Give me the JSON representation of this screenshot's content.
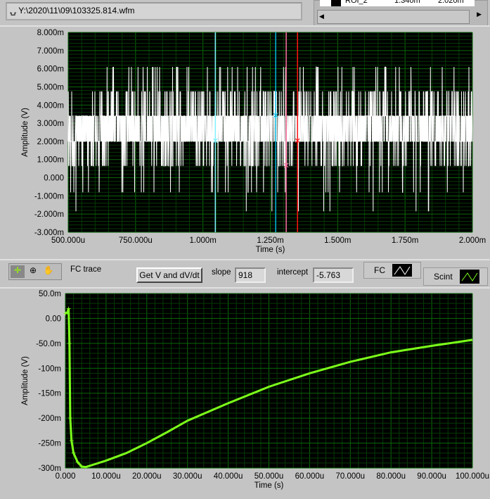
{
  "file_path": "Y:\\2020\\11\\09\\103325.814.wfm",
  "roi_table": {
    "row": [
      "ROI_2",
      "1.340m",
      "2.020m"
    ]
  },
  "toolbar": {
    "graph_name": "FC trace",
    "get_button": "Get V and dV/dt",
    "slope_label": "slope",
    "slope_value": "918",
    "intercept_label": "intercept",
    "intercept_value": "-5.763",
    "fc_label": "FC",
    "scint_label": "Scint",
    "tools": [
      "cursor-tool-icon",
      "zoom-tool-icon",
      "pan-hand-icon"
    ]
  },
  "colors": {
    "plot_bg": "#000000",
    "grid": "#0a6a0a",
    "trace_top": "#ffffff",
    "trace_bottom": "#7cff1a",
    "cursor_1": "#7ff0ff",
    "cursor_2": "#00b8e0",
    "cursor_3": "#ff6f9f",
    "cursor_4": "#ff1010"
  },
  "chart_data": [
    {
      "type": "line",
      "xlabel": "Time (s)",
      "ylabel": "Amplitude (V)",
      "xlim": [
        0.0005,
        0.002
      ],
      "ylim": [
        -0.003,
        0.008
      ],
      "xticks": [
        "500.000u",
        "750.000u",
        "1.000m",
        "1.250m",
        "1.500m",
        "1.750m",
        "2.000m"
      ],
      "yticks": [
        "8.000m",
        "7.000m",
        "6.000m",
        "5.000m",
        "4.000m",
        "3.000m",
        "2.000m",
        "1.000m",
        "0.000",
        "-1.000m",
        "-2.000m",
        "-3.000m"
      ],
      "grid": true,
      "levels": [
        -0.00185,
        -0.0008,
        0.00065,
        0.002,
        0.0034,
        0.00475,
        0.0061
      ],
      "cursors": [
        {
          "x": 0.001046,
          "y": 0.00203
        },
        {
          "x": 0.00127,
          "y": 0.00343
        },
        {
          "x": 0.001309,
          "y": 0.00067
        },
        {
          "x": 0.001351,
          "y": 0.00203
        }
      ]
    },
    {
      "type": "line",
      "xlabel": "Time (s)",
      "ylabel": "Amplitude (V)",
      "xlim": [
        0,
        0.0001
      ],
      "ylim": [
        -0.3,
        0.05
      ],
      "xticks": [
        "0.000",
        "10.000u",
        "20.000u",
        "30.000u",
        "40.000u",
        "50.000u",
        "60.000u",
        "70.000u",
        "80.000u",
        "90.000u",
        "100.000u"
      ],
      "yticks": [
        "50.0m",
        "0.00",
        "-50.0m",
        "-100m",
        "-150m",
        "-200m",
        "-250m",
        "-300m"
      ],
      "grid": true,
      "x": [
        0,
        5e-07,
        8e-07,
        1e-06,
        1.2e-06,
        1.5e-06,
        2e-06,
        3e-06,
        4e-06,
        5e-06,
        7e-06,
        1e-05,
        1.5e-05,
        2e-05,
        2.5e-05,
        3e-05,
        4e-05,
        5e-05,
        6e-05,
        7e-05,
        8e-05,
        9e-05,
        0.0001
      ],
      "y": [
        0.01,
        0.012,
        0.02,
        -0.05,
        -0.2,
        -0.245,
        -0.27,
        -0.288,
        -0.297,
        -0.298,
        -0.293,
        -0.285,
        -0.27,
        -0.25,
        -0.228,
        -0.205,
        -0.17,
        -0.137,
        -0.11,
        -0.087,
        -0.068,
        -0.055,
        -0.043
      ]
    }
  ]
}
